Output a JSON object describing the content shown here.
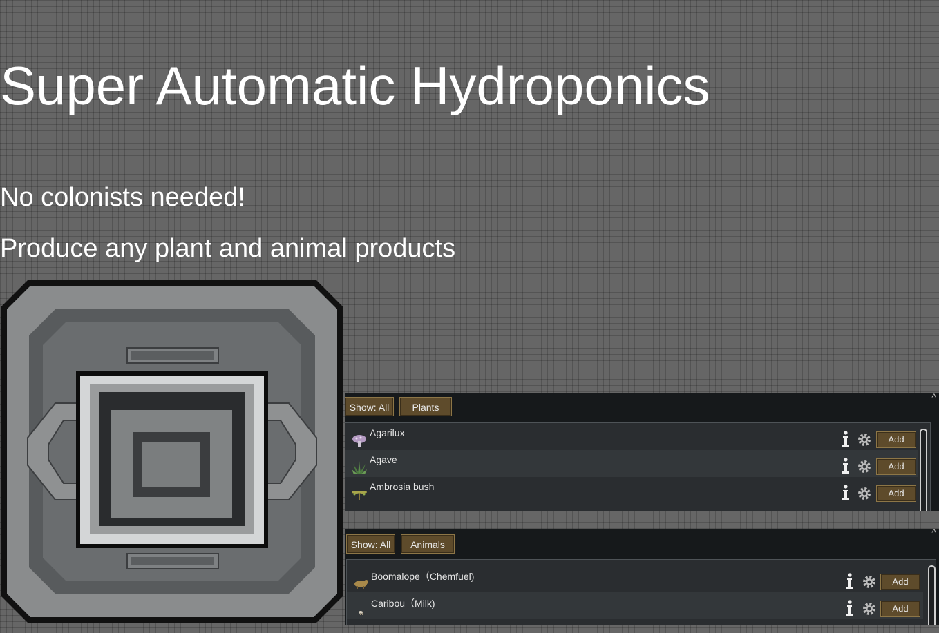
{
  "title": "Super Automatic Hydroponics",
  "subtitles": [
    "No colonists needed!",
    "Produce any plant and animal products"
  ],
  "plants_panel": {
    "filter_label": "Show: All",
    "category_label": "Plants",
    "items": [
      {
        "name": "Agarilux",
        "icon": "agarilux-mushroom-icon",
        "add_label": "Add"
      },
      {
        "name": "Agave",
        "icon": "agave-plant-icon",
        "add_label": "Add"
      },
      {
        "name": "Ambrosia bush",
        "icon": "ambrosia-bush-icon",
        "add_label": "Add"
      }
    ]
  },
  "animals_panel": {
    "filter_label": "Show: All",
    "category_label": "Animals",
    "items": [
      {
        "name": "Boomalope（Chemfuel)",
        "icon": "boomalope-icon",
        "add_label": "Add"
      },
      {
        "name": "Caribou（Milk)",
        "icon": "caribou-icon",
        "add_label": "Add"
      }
    ]
  },
  "colors": {
    "background": "#666666",
    "panel": "#16191b",
    "button": "#5e4b2b",
    "button_border": "#8d7647",
    "text": "#ffffff"
  }
}
